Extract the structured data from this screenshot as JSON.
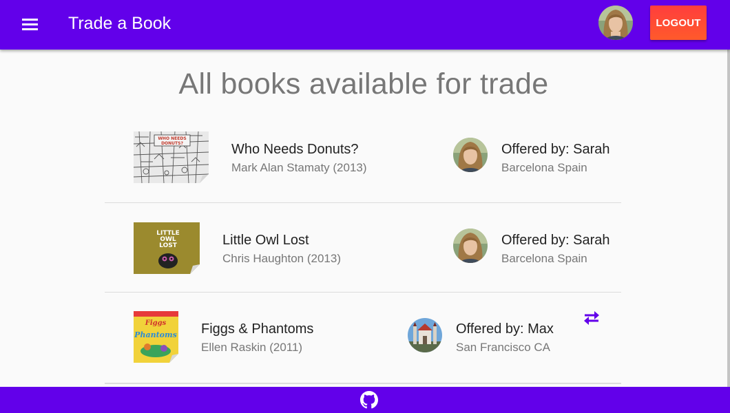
{
  "header": {
    "title": "Trade a Book",
    "logout_label": "LOGOUT",
    "menu_icon": "menu-icon",
    "user_avatar": "avatar"
  },
  "page": {
    "heading": "All books available for trade"
  },
  "books": [
    {
      "title": "Who Needs Donuts?",
      "author": "Mark Alan Stamaty (2013)",
      "offered_by": "Offered by: Sarah",
      "location": "Barcelona Spain",
      "cover_text": "WHO NEEDS DONUTS?"
    },
    {
      "title": "Little Owl Lost",
      "author": "Chris Haughton (2013)",
      "offered_by": "Offered by: Sarah",
      "location": "Barcelona Spain",
      "cover_text": "LITTLE OWL LOST"
    },
    {
      "title": "Figgs & Phantoms",
      "author": "Ellen Raskin (2011)",
      "offered_by": "Offered by: Max",
      "location": "San Francisco CA",
      "cover_text": "Figgs Phantoms"
    }
  ],
  "footer": {
    "icon": "github-icon"
  },
  "colors": {
    "primary": "#6200ea",
    "logout": "#ff4a33",
    "heading": "#777777"
  }
}
